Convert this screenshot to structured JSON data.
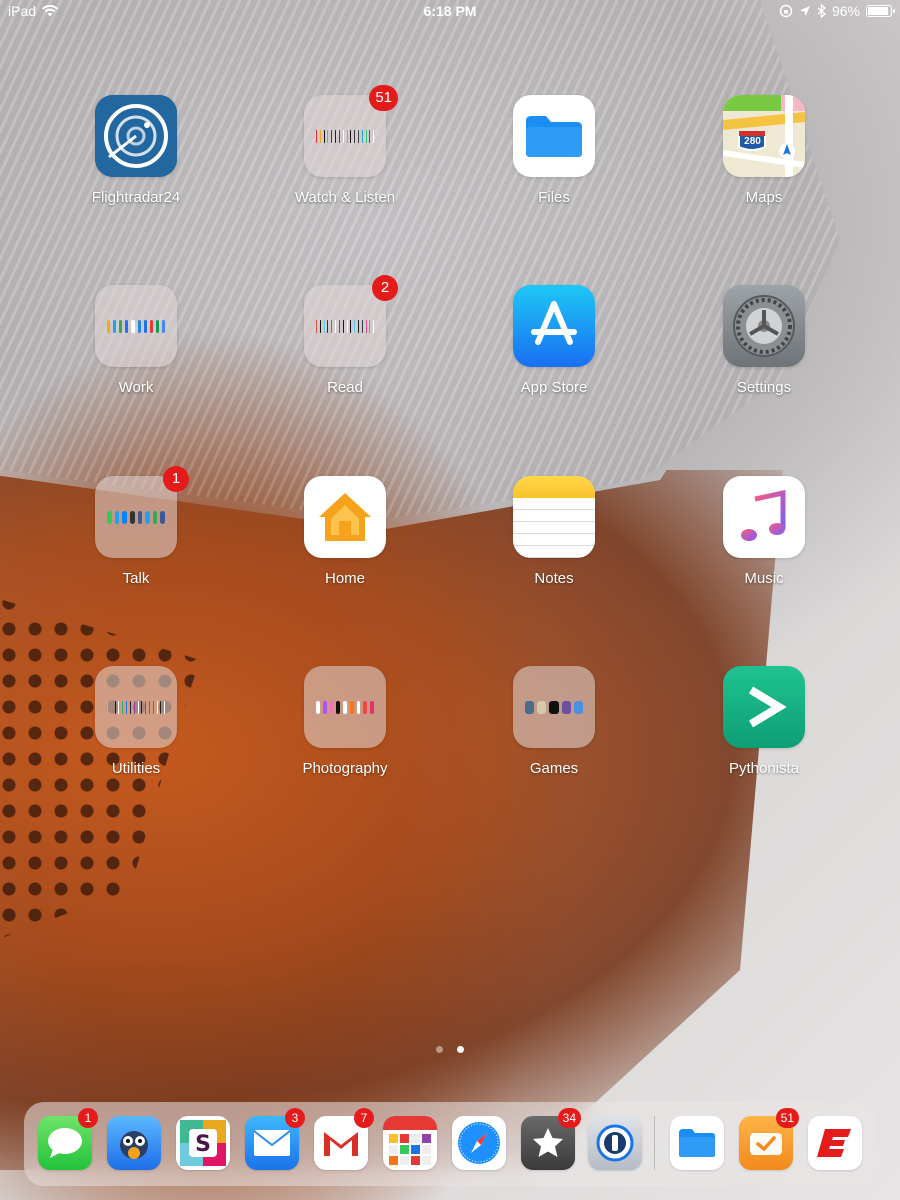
{
  "status_bar": {
    "device": "iPad",
    "time": "6:18 PM",
    "battery_text": "96%",
    "battery_level": 0.96
  },
  "apps": [
    {
      "label": "Flightradar24",
      "badge": ""
    },
    {
      "label": "Watch & Listen",
      "badge": "51"
    },
    {
      "label": "Files",
      "badge": ""
    },
    {
      "label": "Maps",
      "badge": ""
    },
    {
      "label": "Work",
      "badge": ""
    },
    {
      "label": "Read",
      "badge": "2"
    },
    {
      "label": "App Store",
      "badge": ""
    },
    {
      "label": "Settings",
      "badge": ""
    },
    {
      "label": "Talk",
      "badge": "1"
    },
    {
      "label": "Home",
      "badge": ""
    },
    {
      "label": "Notes",
      "badge": ""
    },
    {
      "label": "Music",
      "badge": ""
    },
    {
      "label": "Utilities",
      "badge": ""
    },
    {
      "label": "Photography",
      "badge": ""
    },
    {
      "label": "Games",
      "badge": ""
    },
    {
      "label": "Pythonista",
      "badge": ""
    }
  ],
  "maps_sign": "280",
  "page_indicator": {
    "pages": 2,
    "current": 2
  },
  "dock": [
    {
      "name": "Messages",
      "badge": "1"
    },
    {
      "name": "Tweetbot",
      "badge": ""
    },
    {
      "name": "Slack",
      "badge": ""
    },
    {
      "name": "Mail",
      "badge": "3"
    },
    {
      "name": "Gmail",
      "badge": "7"
    },
    {
      "name": "Fantastical",
      "badge": ""
    },
    {
      "name": "Safari",
      "badge": ""
    },
    {
      "name": "Reeder",
      "badge": "34"
    },
    {
      "name": "1Password",
      "badge": ""
    },
    {
      "name": "Files",
      "badge": ""
    },
    {
      "name": "Tasks",
      "badge": "51"
    },
    {
      "name": "ESPN",
      "badge": ""
    }
  ],
  "colors": {
    "badge": "#e51b1b",
    "label": "#ffffff"
  }
}
